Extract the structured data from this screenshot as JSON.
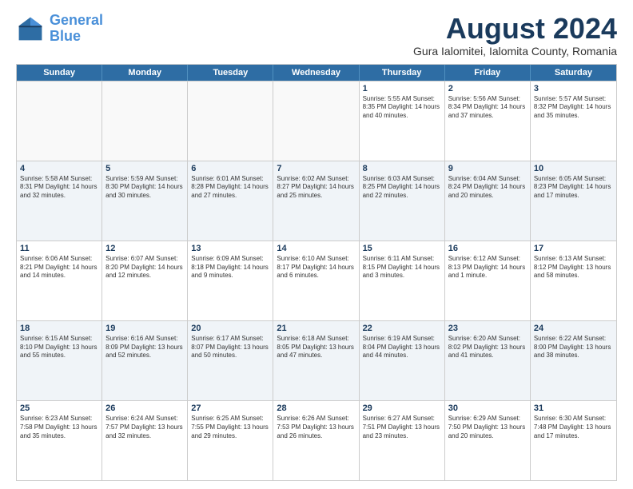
{
  "logo": {
    "line1": "General",
    "line2": "Blue"
  },
  "title": {
    "month_year": "August 2024",
    "location": "Gura Ialomitei, Ialomita County, Romania"
  },
  "headers": [
    "Sunday",
    "Monday",
    "Tuesday",
    "Wednesday",
    "Thursday",
    "Friday",
    "Saturday"
  ],
  "weeks": [
    [
      {
        "day": "",
        "text": ""
      },
      {
        "day": "",
        "text": ""
      },
      {
        "day": "",
        "text": ""
      },
      {
        "day": "",
        "text": ""
      },
      {
        "day": "1",
        "text": "Sunrise: 5:55 AM\nSunset: 8:35 PM\nDaylight: 14 hours and 40 minutes."
      },
      {
        "day": "2",
        "text": "Sunrise: 5:56 AM\nSunset: 8:34 PM\nDaylight: 14 hours and 37 minutes."
      },
      {
        "day": "3",
        "text": "Sunrise: 5:57 AM\nSunset: 8:32 PM\nDaylight: 14 hours and 35 minutes."
      }
    ],
    [
      {
        "day": "4",
        "text": "Sunrise: 5:58 AM\nSunset: 8:31 PM\nDaylight: 14 hours and 32 minutes."
      },
      {
        "day": "5",
        "text": "Sunrise: 5:59 AM\nSunset: 8:30 PM\nDaylight: 14 hours and 30 minutes."
      },
      {
        "day": "6",
        "text": "Sunrise: 6:01 AM\nSunset: 8:28 PM\nDaylight: 14 hours and 27 minutes."
      },
      {
        "day": "7",
        "text": "Sunrise: 6:02 AM\nSunset: 8:27 PM\nDaylight: 14 hours and 25 minutes."
      },
      {
        "day": "8",
        "text": "Sunrise: 6:03 AM\nSunset: 8:25 PM\nDaylight: 14 hours and 22 minutes."
      },
      {
        "day": "9",
        "text": "Sunrise: 6:04 AM\nSunset: 8:24 PM\nDaylight: 14 hours and 20 minutes."
      },
      {
        "day": "10",
        "text": "Sunrise: 6:05 AM\nSunset: 8:23 PM\nDaylight: 14 hours and 17 minutes."
      }
    ],
    [
      {
        "day": "11",
        "text": "Sunrise: 6:06 AM\nSunset: 8:21 PM\nDaylight: 14 hours and 14 minutes."
      },
      {
        "day": "12",
        "text": "Sunrise: 6:07 AM\nSunset: 8:20 PM\nDaylight: 14 hours and 12 minutes."
      },
      {
        "day": "13",
        "text": "Sunrise: 6:09 AM\nSunset: 8:18 PM\nDaylight: 14 hours and 9 minutes."
      },
      {
        "day": "14",
        "text": "Sunrise: 6:10 AM\nSunset: 8:17 PM\nDaylight: 14 hours and 6 minutes."
      },
      {
        "day": "15",
        "text": "Sunrise: 6:11 AM\nSunset: 8:15 PM\nDaylight: 14 hours and 3 minutes."
      },
      {
        "day": "16",
        "text": "Sunrise: 6:12 AM\nSunset: 8:13 PM\nDaylight: 14 hours and 1 minute."
      },
      {
        "day": "17",
        "text": "Sunrise: 6:13 AM\nSunset: 8:12 PM\nDaylight: 13 hours and 58 minutes."
      }
    ],
    [
      {
        "day": "18",
        "text": "Sunrise: 6:15 AM\nSunset: 8:10 PM\nDaylight: 13 hours and 55 minutes."
      },
      {
        "day": "19",
        "text": "Sunrise: 6:16 AM\nSunset: 8:09 PM\nDaylight: 13 hours and 52 minutes."
      },
      {
        "day": "20",
        "text": "Sunrise: 6:17 AM\nSunset: 8:07 PM\nDaylight: 13 hours and 50 minutes."
      },
      {
        "day": "21",
        "text": "Sunrise: 6:18 AM\nSunset: 8:05 PM\nDaylight: 13 hours and 47 minutes."
      },
      {
        "day": "22",
        "text": "Sunrise: 6:19 AM\nSunset: 8:04 PM\nDaylight: 13 hours and 44 minutes."
      },
      {
        "day": "23",
        "text": "Sunrise: 6:20 AM\nSunset: 8:02 PM\nDaylight: 13 hours and 41 minutes."
      },
      {
        "day": "24",
        "text": "Sunrise: 6:22 AM\nSunset: 8:00 PM\nDaylight: 13 hours and 38 minutes."
      }
    ],
    [
      {
        "day": "25",
        "text": "Sunrise: 6:23 AM\nSunset: 7:58 PM\nDaylight: 13 hours and 35 minutes."
      },
      {
        "day": "26",
        "text": "Sunrise: 6:24 AM\nSunset: 7:57 PM\nDaylight: 13 hours and 32 minutes."
      },
      {
        "day": "27",
        "text": "Sunrise: 6:25 AM\nSunset: 7:55 PM\nDaylight: 13 hours and 29 minutes."
      },
      {
        "day": "28",
        "text": "Sunrise: 6:26 AM\nSunset: 7:53 PM\nDaylight: 13 hours and 26 minutes."
      },
      {
        "day": "29",
        "text": "Sunrise: 6:27 AM\nSunset: 7:51 PM\nDaylight: 13 hours and 23 minutes."
      },
      {
        "day": "30",
        "text": "Sunrise: 6:29 AM\nSunset: 7:50 PM\nDaylight: 13 hours and 20 minutes."
      },
      {
        "day": "31",
        "text": "Sunrise: 6:30 AM\nSunset: 7:48 PM\nDaylight: 13 hours and 17 minutes."
      }
    ]
  ]
}
